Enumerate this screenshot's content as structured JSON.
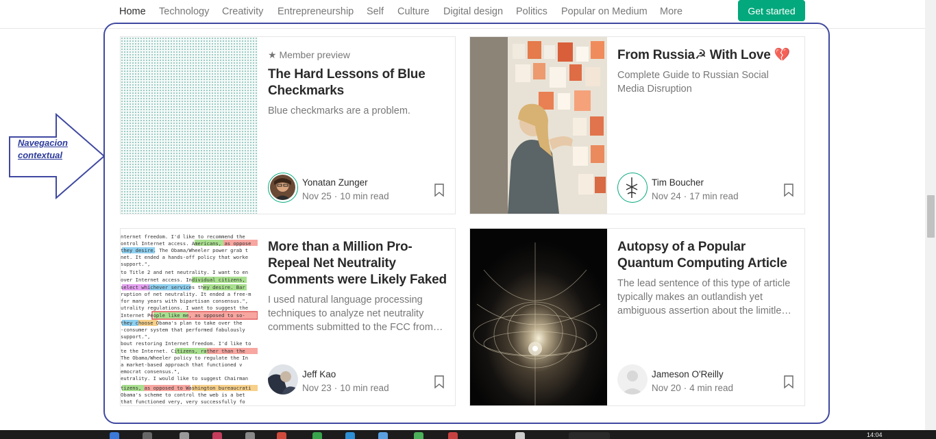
{
  "nav": {
    "items": [
      "Home",
      "Technology",
      "Creativity",
      "Entrepreneurship",
      "Self",
      "Culture",
      "Digital design",
      "Politics",
      "Popular on Medium",
      "More"
    ],
    "active": "Home",
    "cta_label": "Get started"
  },
  "annotation": {
    "label": "Navegacion contextual",
    "color": "#3f48a0"
  },
  "cards": [
    {
      "member_label": "★ Member preview",
      "title": "The Hard Lessons of Blue Checkmarks",
      "subtitle": "Blue checkmarks are a problem.",
      "author": "Yonatan Zunger",
      "date": "Nov 25",
      "read_time": "10 min read"
    },
    {
      "title": "From Russia☭ With Love 💔",
      "subtitle": "Complete Guide to Russian Social Media Disruption",
      "author": "Tim Boucher",
      "date": "Nov 24",
      "read_time": "17 min read"
    },
    {
      "title": "More than a Million Pro-Repeal Net Neutrality Comments were Likely Faked",
      "subtitle": "I used natural language processing techniques to analyze net neutrality comments submitted to the FCC from…",
      "author": "Jeff Kao",
      "date": "Nov 23",
      "read_time": "10 min read"
    },
    {
      "title": "Autopsy of a Popular Quantum Computing Article",
      "subtitle": "The lead sentence of this type of article typically makes an outlandish yet ambiguous assertion about the limitle…",
      "author": "Jameson O'Reilly",
      "date": "Nov 20",
      "read_time": "4 min read"
    }
  ],
  "taskbar": {
    "clock": "14:04"
  },
  "colors": {
    "accent": "#03a87c",
    "annotation": "#3f48a0"
  }
}
